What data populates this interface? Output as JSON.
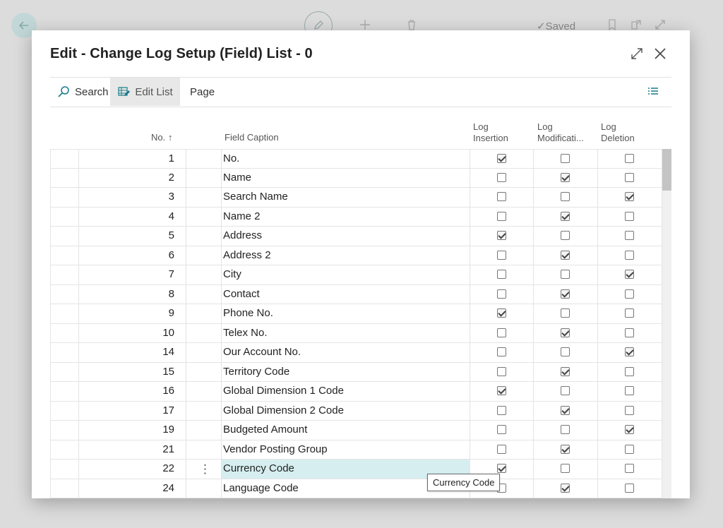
{
  "background": {
    "saved_label": "Saved"
  },
  "dialog": {
    "title": "Edit - Change Log Setup (Field) List - 0"
  },
  "actions": {
    "search": "Search",
    "edit_list": "Edit List",
    "page": "Page"
  },
  "columns": {
    "no": "No. ↑",
    "caption": "Field Caption",
    "log_insertion_1": "Log",
    "log_insertion_2": "Insertion",
    "log_modification_1": "Log",
    "log_modification_2": "Modificati...",
    "log_deletion_1": "Log",
    "log_deletion_2": "Deletion"
  },
  "rows": [
    {
      "no": "1",
      "caption": "No.",
      "ins": true,
      "mod": false,
      "del": false
    },
    {
      "no": "2",
      "caption": "Name",
      "ins": false,
      "mod": true,
      "del": false
    },
    {
      "no": "3",
      "caption": "Search Name",
      "ins": false,
      "mod": false,
      "del": true
    },
    {
      "no": "4",
      "caption": "Name 2",
      "ins": false,
      "mod": true,
      "del": false
    },
    {
      "no": "5",
      "caption": "Address",
      "ins": true,
      "mod": false,
      "del": false
    },
    {
      "no": "6",
      "caption": "Address 2",
      "ins": false,
      "mod": true,
      "del": false
    },
    {
      "no": "7",
      "caption": "City",
      "ins": false,
      "mod": false,
      "del": true
    },
    {
      "no": "8",
      "caption": "Contact",
      "ins": false,
      "mod": true,
      "del": false
    },
    {
      "no": "9",
      "caption": "Phone No.",
      "ins": true,
      "mod": false,
      "del": false
    },
    {
      "no": "10",
      "caption": "Telex No.",
      "ins": false,
      "mod": true,
      "del": false
    },
    {
      "no": "14",
      "caption": "Our Account No.",
      "ins": false,
      "mod": false,
      "del": true
    },
    {
      "no": "15",
      "caption": "Territory Code",
      "ins": false,
      "mod": true,
      "del": false
    },
    {
      "no": "16",
      "caption": "Global Dimension 1 Code",
      "ins": true,
      "mod": false,
      "del": false
    },
    {
      "no": "17",
      "caption": "Global Dimension 2 Code",
      "ins": false,
      "mod": true,
      "del": false
    },
    {
      "no": "19",
      "caption": "Budgeted Amount",
      "ins": false,
      "mod": false,
      "del": true
    },
    {
      "no": "21",
      "caption": "Vendor Posting Group",
      "ins": false,
      "mod": true,
      "del": false
    },
    {
      "no": "22",
      "caption": "Currency Code",
      "ins": true,
      "mod": false,
      "del": false,
      "selected": true
    },
    {
      "no": "24",
      "caption": "Language Code",
      "ins": false,
      "mod": true,
      "del": false
    }
  ],
  "tooltip": "Currency Code",
  "colors": {
    "selected_row": "#d6eef0",
    "edit_list_bg": "#e8e8e8",
    "accent": "#1a7a8a"
  }
}
